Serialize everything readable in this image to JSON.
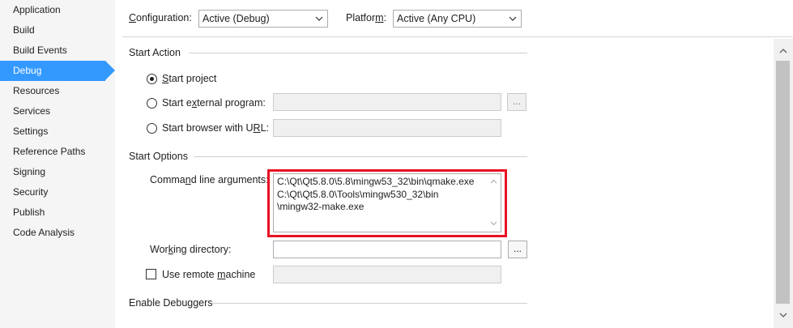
{
  "sidebar": {
    "items": [
      {
        "label": "Application"
      },
      {
        "label": "Build"
      },
      {
        "label": "Build Events"
      },
      {
        "label": "Debug",
        "active": true
      },
      {
        "label": "Resources"
      },
      {
        "label": "Services"
      },
      {
        "label": "Settings"
      },
      {
        "label": "Reference Paths"
      },
      {
        "label": "Signing"
      },
      {
        "label": "Security"
      },
      {
        "label": "Publish"
      },
      {
        "label": "Code Analysis"
      }
    ]
  },
  "topbar": {
    "configuration_label_pre": "",
    "configuration_label_ul": "C",
    "configuration_label_post": "onfiguration:",
    "configuration_value": "Active (Debug)",
    "platform_label_pre": "Platfor",
    "platform_label_ul": "m",
    "platform_label_post": ":",
    "platform_value": "Active (Any CPU)"
  },
  "start_action": {
    "title": "Start Action",
    "start_project": {
      "pre": "",
      "ul": "S",
      "post": "tart project",
      "selected": true
    },
    "start_external": {
      "pre": "Start e",
      "ul": "x",
      "post": "ternal program:",
      "selected": false,
      "value": ""
    },
    "start_browser": {
      "pre": "Start browser with U",
      "ul": "R",
      "post": "L:",
      "selected": false,
      "value": ""
    },
    "browse_label": "..."
  },
  "start_options": {
    "title": "Start Options",
    "cmdline_label_pre": "Comma",
    "cmdline_label_ul": "n",
    "cmdline_label_post": "d line arguments:",
    "cmdline_value": "C:\\Qt\\Qt5.8.0\\5.8\\mingw53_32\\bin\\qmake.exe\nC:\\Qt\\Qt5.8.0\\Tools\\mingw530_32\\bin\n\\mingw32-make.exe",
    "workdir_label_pre": "Wor",
    "workdir_label_ul": "k",
    "workdir_label_post": "ing directory:",
    "workdir_value": "",
    "remote_label_pre": "Use remote ",
    "remote_label_ul": "m",
    "remote_label_post": "achine",
    "remote_checked": false,
    "remote_value": "",
    "browse_label": "..."
  },
  "enable_debuggers": {
    "title": "Enable Debuggers"
  },
  "colors": {
    "accent": "#3399ff",
    "highlight_border": "#e81123"
  }
}
